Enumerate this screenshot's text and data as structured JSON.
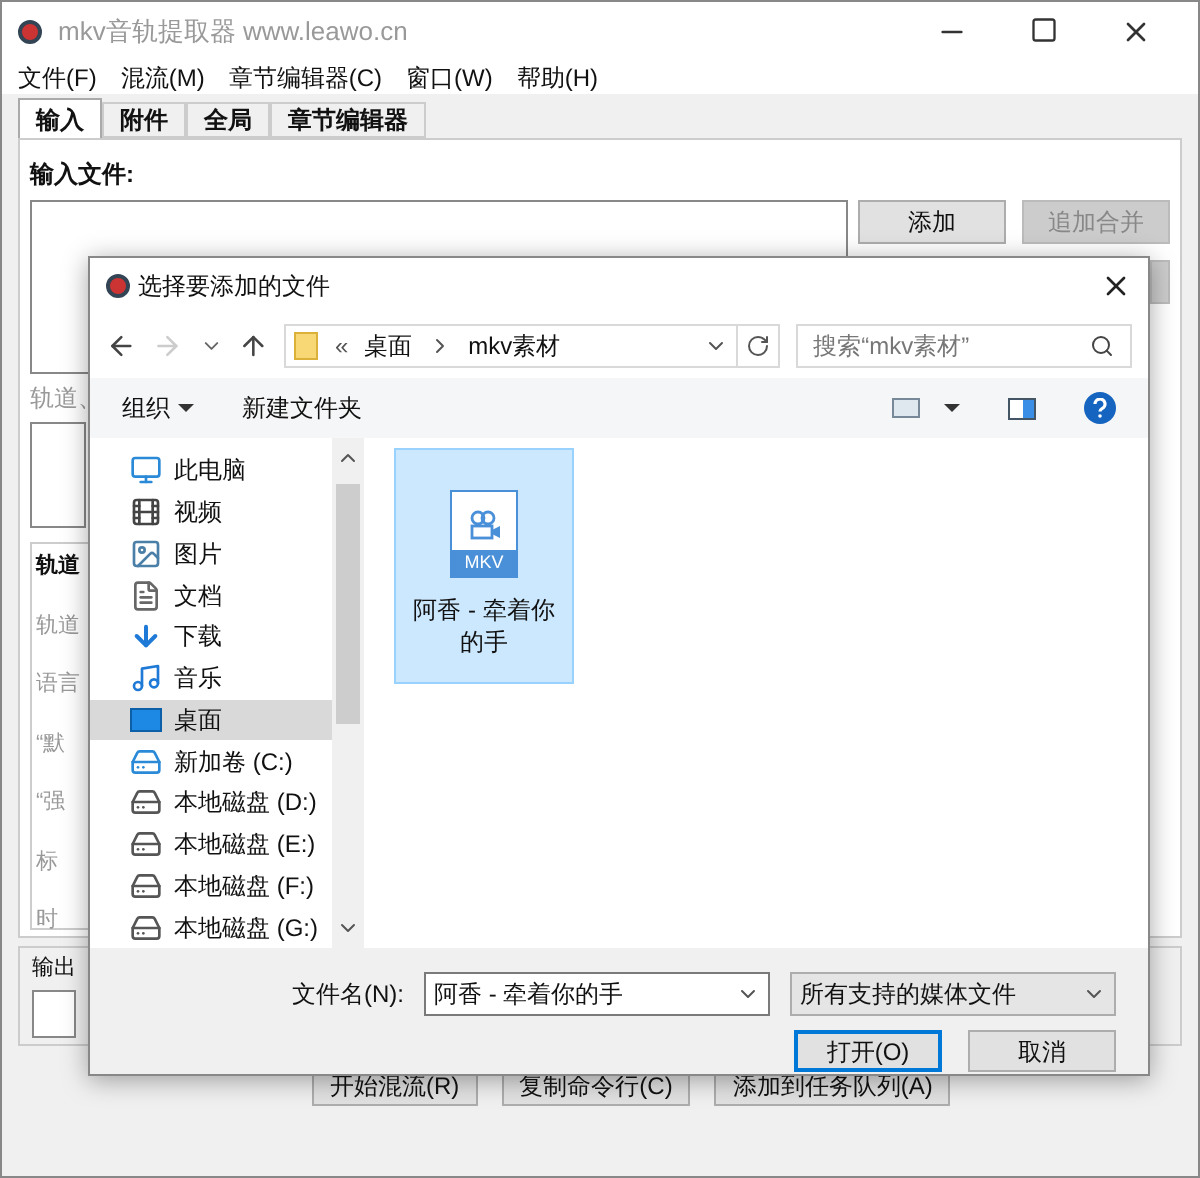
{
  "window": {
    "title": "mkv音轨提取器 www.leawo.cn"
  },
  "menu": [
    "文件(F)",
    "混流(M)",
    "章节编辑器(C)",
    "窗口(W)",
    "帮助(H)"
  ],
  "tabs": [
    {
      "label": "输入",
      "selected": true
    },
    {
      "label": "附件",
      "selected": false
    },
    {
      "label": "全局",
      "selected": false
    },
    {
      "label": "章节编辑器",
      "selected": false
    }
  ],
  "input_files_label": "输入文件:",
  "side_buttons": [
    {
      "label": "添加",
      "disabled": false
    },
    {
      "label": "追加合并",
      "disabled": true
    }
  ],
  "tracks_label": "轨道、",
  "group_title": "轨道",
  "property_labels": [
    "轨道",
    "语言",
    "“默",
    "“强",
    "标",
    "时"
  ],
  "output_label": "输出",
  "bottom_buttons": [
    "开始混流(R)",
    "复制命令行(C)",
    "添加到任务队列(A)"
  ],
  "dialog": {
    "title": "选择要添加的文件",
    "path_prefix": "«",
    "path": [
      "桌面",
      "mkv素材"
    ],
    "search": {
      "placeholder": "搜索“mkv素材”"
    },
    "organize": "组织",
    "new_folder": "新建文件夹",
    "nav_items": [
      {
        "label": "此电脑",
        "kind": "pc",
        "selected": false
      },
      {
        "label": "视频",
        "kind": "video",
        "selected": false
      },
      {
        "label": "图片",
        "kind": "pictures",
        "selected": false
      },
      {
        "label": "文档",
        "kind": "documents",
        "selected": false
      },
      {
        "label": "下载",
        "kind": "downloads",
        "selected": false
      },
      {
        "label": "音乐",
        "kind": "music",
        "selected": false
      },
      {
        "label": "桌面",
        "kind": "desktop",
        "selected": true
      },
      {
        "label": "新加卷 (C:)",
        "kind": "system-drive",
        "selected": false
      },
      {
        "label": "本地磁盘 (D:)",
        "kind": "drive",
        "selected": false
      },
      {
        "label": "本地磁盘 (E:)",
        "kind": "drive",
        "selected": false
      },
      {
        "label": "本地磁盘 (F:)",
        "kind": "drive",
        "selected": false
      },
      {
        "label": "本地磁盘 (G:)",
        "kind": "drive",
        "selected": false
      }
    ],
    "files": [
      {
        "name": "阿香 - 牵着你的手",
        "badge": "MKV",
        "selected": true
      }
    ],
    "filename_label": "文件名(N):",
    "filename": "阿香 - 牵着你的手",
    "filter": "所有支持的媒体文件",
    "buttons": [
      {
        "label": "打开(O)",
        "primary": true
      },
      {
        "label": "取消",
        "primary": false
      }
    ]
  }
}
